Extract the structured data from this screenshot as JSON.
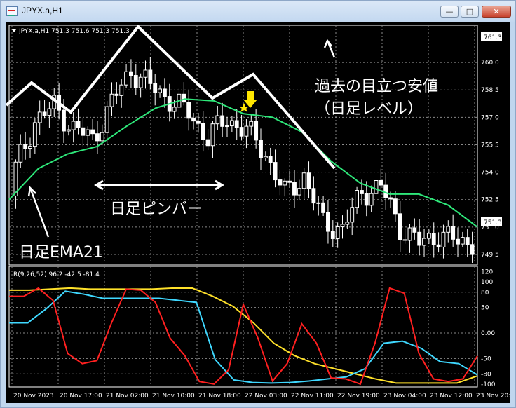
{
  "window": {
    "title": "JPYX.a,H1",
    "minimize_glyph": "—",
    "maximize_glyph": "□",
    "close_glyph": "✕"
  },
  "main_info": "JPYX.a,H1  751.3 751.6 751.3 751.3",
  "sub_info": "R(9,26,52) 96.2 -42.5 -81.4",
  "price_axis": {
    "ticks": [
      "760.0",
      "758.5",
      "757.0",
      "755.5",
      "754.0",
      "752.5",
      "751.0",
      "749.5"
    ],
    "top_label": "761.3",
    "current_label": "751.3"
  },
  "osc_axis": {
    "ticks": [
      "120",
      "100",
      "80",
      "50",
      "0.00",
      "-50",
      "-80",
      "-100"
    ]
  },
  "time_axis": {
    "labels": [
      "20 Nov 2023",
      "20 Nov 17:00",
      "21 Nov 02:00",
      "21 Nov 10:00",
      "21 Nov 18:00",
      "22 Nov 03:00",
      "22 Nov 11:00",
      "22 Nov 19:00",
      "23 Nov 04:00",
      "23 Nov 12:00",
      "23 Nov 20:00"
    ]
  },
  "annotations": {
    "past_low_line1": "過去の目立つ安値",
    "past_low_line2": "（日足レベル）",
    "pinbar": "日足ピンバー",
    "ema": "日足EMA21"
  },
  "colors": {
    "background": "#000000",
    "grid": "#8a8a8a",
    "candle": "#ffffff",
    "ema_line": "#2ee87a",
    "osc_fast": "#ff2020",
    "osc_mid": "#3fd8ff",
    "osc_slow": "#ffe12a",
    "marker": "#ffe600",
    "annotation": "#ffffff"
  },
  "chart_data": {
    "type": "line",
    "symbol": "JPYX.a",
    "timeframe": "H1",
    "ohlc_last": {
      "open": 751.3,
      "high": 751.6,
      "low": 751.3,
      "close": 751.3
    },
    "x": [
      "20 Nov 2023",
      "20 Nov 17:00",
      "21 Nov 02:00",
      "21 Nov 10:00",
      "21 Nov 18:00",
      "22 Nov 03:00",
      "22 Nov 11:00",
      "22 Nov 19:00",
      "23 Nov 04:00",
      "23 Nov 12:00",
      "23 Nov 20:00"
    ],
    "price_closes": [
      754.2,
      756.8,
      757.6,
      756.4,
      755.8,
      757.8,
      759.6,
      758.7,
      758.0,
      757.2,
      755.9,
      756.9,
      756.3,
      755.0,
      752.8,
      753.8,
      751.2,
      750.9,
      752.9,
      753.2,
      751.0,
      750.1,
      750.6,
      750.2
    ],
    "series": [
      {
        "name": "JPYX.a,H1",
        "panel": "price",
        "ylim": [
          749.0,
          761.5
        ]
      },
      {
        "name": "R(9,26,52)",
        "panel": "oscillator",
        "ylim": [
          -103,
          125
        ]
      }
    ],
    "ema_values": [
      752.5,
      754.2,
      755.0,
      755.4,
      756.5,
      757.5,
      758.0,
      757.9,
      757.2,
      757.0,
      756.2,
      754.6,
      753.4,
      752.8,
      752.8,
      752.2,
      751.0
    ],
    "oscillator_fast": [
      72,
      72,
      88,
      64,
      -40,
      -60,
      -54,
      20,
      86,
      84,
      60,
      -10,
      -44,
      -95,
      -100,
      -72,
      56,
      -10,
      -94,
      -60,
      18,
      -20,
      -88,
      -90,
      -100,
      -20,
      88,
      78,
      -40,
      -90,
      -95,
      -90,
      -45
    ],
    "oscillator_mid": [
      20,
      20,
      48,
      82,
      76,
      68,
      68,
      68,
      68,
      64,
      60,
      -52,
      -92,
      -97,
      -98,
      -97,
      -94,
      -90,
      -86,
      -70,
      -20,
      -16,
      -30,
      -56,
      -60,
      -82
    ],
    "oscillator_slow": [
      84,
      84,
      86,
      88,
      86,
      86,
      86,
      86,
      88,
      88,
      72,
      52,
      20,
      -20,
      -44,
      -60,
      -70,
      -80,
      -90,
      -98,
      -98,
      -98,
      -98,
      -84
    ],
    "oscillator_last": {
      "fast": 96.2,
      "mid": -42.5,
      "slow": -81.4
    },
    "price_ticks": [
      760.0,
      758.5,
      757.0,
      755.5,
      754.0,
      752.5,
      751.0,
      749.5
    ],
    "osc_ticks": [
      120,
      100,
      80,
      50,
      0,
      -50,
      -80,
      -100
    ],
    "grid": true
  }
}
